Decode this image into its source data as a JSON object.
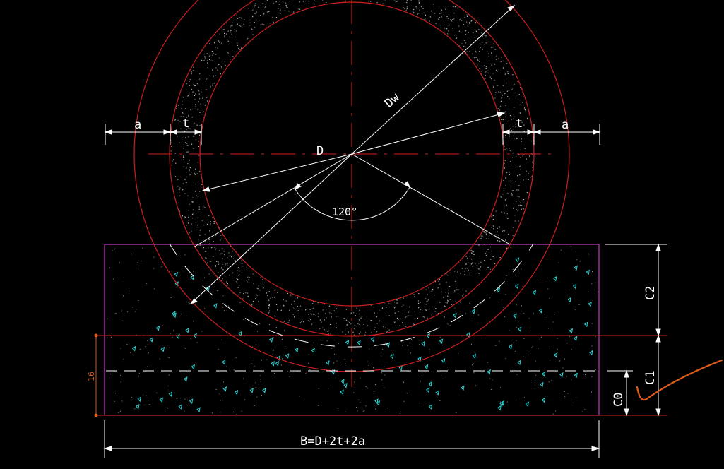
{
  "labels": {
    "a_left": "a",
    "t_left": "t",
    "t_right": "t",
    "a_right": "a",
    "diameter_outer": "Dw",
    "diameter_inner": "D",
    "angle": "120°",
    "c2": "C2",
    "c1": "C1",
    "c0": "C0",
    "height_small": "16",
    "base_width": "B=D+2t+2a"
  },
  "colors": {
    "background": "#000000",
    "circles": "#cc1f1f",
    "dimension_lines": "#ffffff",
    "base_outline": "#cc33cc",
    "gravel_marks": "#29d6d6",
    "annotation_pen": "#e05a1a"
  }
}
